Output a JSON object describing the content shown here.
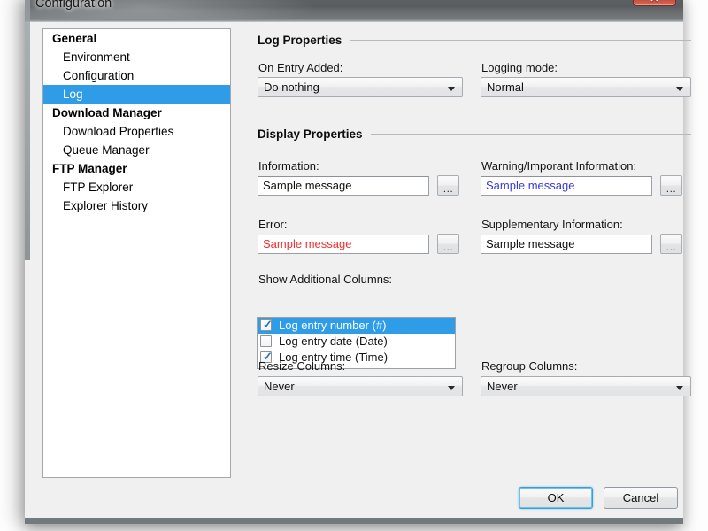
{
  "window": {
    "title": "Configuration",
    "close_icon": "close-icon",
    "close_glyph": "✕"
  },
  "sidebar": {
    "nodes": [
      {
        "label": "General",
        "type": "group",
        "selected": false
      },
      {
        "label": "Environment",
        "type": "item",
        "selected": false
      },
      {
        "label": "Configuration",
        "type": "item",
        "selected": false
      },
      {
        "label": "Log",
        "type": "item",
        "selected": true
      },
      {
        "label": "Download Manager",
        "type": "group",
        "selected": false
      },
      {
        "label": "Download Properties",
        "type": "item",
        "selected": false
      },
      {
        "label": "Queue Manager",
        "type": "item",
        "selected": false
      },
      {
        "label": "FTP Manager",
        "type": "group",
        "selected": false
      },
      {
        "label": "FTP Explorer",
        "type": "item",
        "selected": false
      },
      {
        "label": "Explorer History",
        "type": "item",
        "selected": false
      }
    ]
  },
  "log_properties": {
    "group_title": "Log Properties",
    "on_entry_added": {
      "label": "On Entry Added:",
      "value": "Do nothing",
      "arrow_icon": "chevron-down-icon"
    },
    "logging_mode": {
      "label": "Logging mode:",
      "value": "Normal",
      "arrow_icon": "chevron-down-icon"
    }
  },
  "display_properties": {
    "group_title": "Display Properties",
    "browse_label": "...",
    "information": {
      "label": "Information:",
      "value": "Sample message",
      "color": "#101010"
    },
    "warning": {
      "label": "Warning/Imporant Information:",
      "value": "Sample message",
      "color": "#3a3ad6"
    },
    "error": {
      "label": "Error:",
      "value": "Sample message",
      "color": "#f03030"
    },
    "supplementary": {
      "label": "Supplementary Information:",
      "value": "Sample message",
      "color": "#101010"
    },
    "additional_columns": {
      "label": "Show Additional Columns:",
      "rows": [
        {
          "label": "Log entry number (#)",
          "checked": true,
          "selected": true,
          "check_glyph": "✓"
        },
        {
          "label": "Log entry date (Date)",
          "checked": false,
          "selected": false,
          "check_glyph": ""
        },
        {
          "label": "Log entry time (Time)",
          "checked": true,
          "selected": false,
          "check_glyph": "✓"
        }
      ]
    },
    "resize_columns": {
      "label": "Resize Columns:",
      "value": "Never",
      "arrow_icon": "chevron-down-icon"
    },
    "regroup_columns": {
      "label": "Regroup Columns:",
      "value": "Never",
      "arrow_icon": "chevron-down-icon"
    }
  },
  "footer": {
    "ok_label": "OK",
    "cancel_label": "Cancel"
  },
  "theme": {
    "selection_blue": "#2f9ce8",
    "dialog_gray": "#f0f0f0",
    "default_button_outline": "#3b9dd6"
  }
}
